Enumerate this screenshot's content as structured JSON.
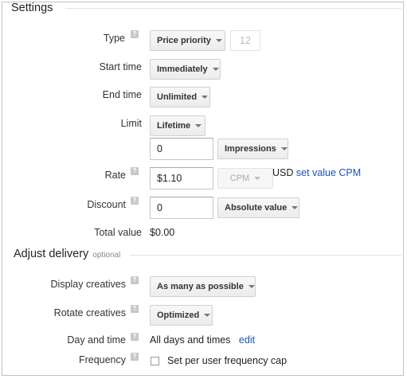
{
  "settings": {
    "title": "Settings",
    "type": {
      "label": "Type",
      "value": "Price priority",
      "priority_value": "12"
    },
    "start_time": {
      "label": "Start time",
      "value": "Immediately"
    },
    "end_time": {
      "label": "End time",
      "value": "Unlimited"
    },
    "limit": {
      "label": "Limit",
      "value": "Lifetime",
      "amount": "0",
      "unit": "Impressions"
    },
    "rate": {
      "label": "Rate",
      "value": "$1.10",
      "unit": "CPM",
      "currency": "USD",
      "link": "set value CPM"
    },
    "discount": {
      "label": "Discount",
      "value": "0",
      "type": "Absolute value"
    },
    "total_value": {
      "label": "Total value",
      "value": "$0.00"
    }
  },
  "delivery": {
    "title": "Adjust delivery",
    "optional_label": "optional",
    "display_creatives": {
      "label": "Display creatives",
      "value": "As many as possible"
    },
    "rotate_creatives": {
      "label": "Rotate creatives",
      "value": "Optimized"
    },
    "day_and_time": {
      "label": "Day and time",
      "value": "All days and times",
      "edit_link": "edit"
    },
    "frequency": {
      "label": "Frequency",
      "checkbox_label": "Set per user frequency cap",
      "checked": false
    }
  },
  "icons": {
    "help": "question-mark",
    "dropdown": "chevron-down"
  },
  "colors": {
    "link": "#1a53b3",
    "border": "#b9c3cf"
  }
}
